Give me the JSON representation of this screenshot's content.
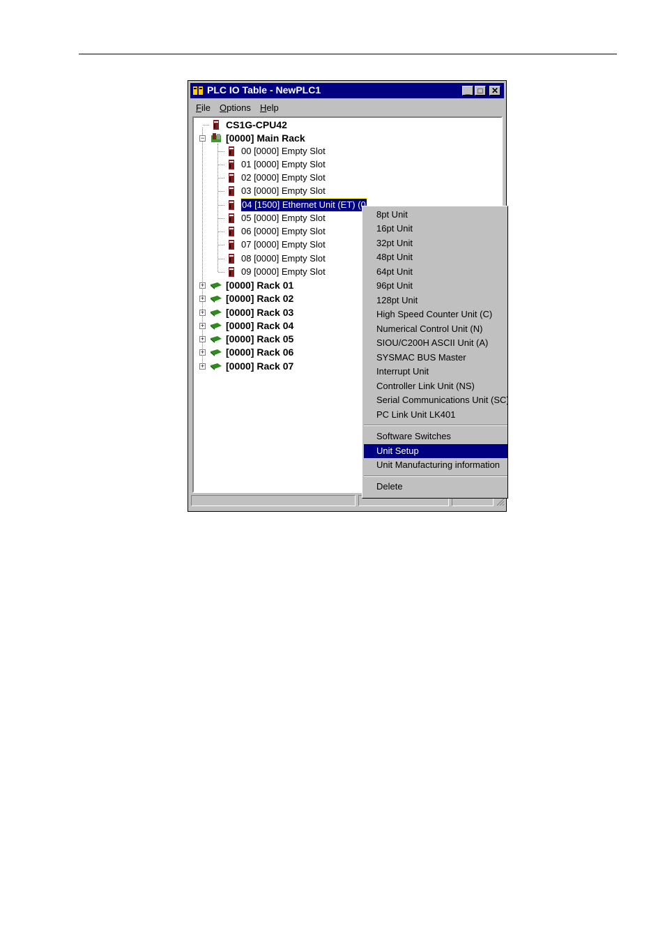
{
  "window": {
    "title": "PLC IO Table - NewPLC1",
    "min_glyph": "_",
    "max_glyph": "□",
    "close_glyph": "✕"
  },
  "menu": {
    "file": "File",
    "options": "Options",
    "help": "Help"
  },
  "tree": {
    "cpu": "CS1G-CPU42",
    "main_rack": "[0000] Main Rack",
    "slots": [
      "00 [0000] Empty Slot",
      "01 [0000] Empty Slot",
      "02 [0000] Empty Slot",
      "03 [0000] Empty Slot",
      "04 [1500] Ethernet Unit (ET) (0",
      "05 [0000] Empty Slot",
      "06 [0000] Empty Slot",
      "07 [0000] Empty Slot",
      "08 [0000] Empty Slot",
      "09 [0000] Empty Slot"
    ],
    "racks": [
      "[0000] Rack 01",
      "[0000] Rack 02",
      "[0000] Rack 03",
      "[0000] Rack 04",
      "[0000] Rack 05",
      "[0000] Rack 06",
      "[0000] Rack 07"
    ],
    "selected_slot": "04 [1500] Ethernet Unit (ET) (0"
  },
  "context_menu": {
    "items": [
      "8pt Unit",
      "16pt Unit",
      "32pt Unit",
      "48pt Unit",
      "64pt Unit",
      "96pt Unit",
      "128pt Unit",
      "High Speed Counter Unit (C)",
      "Numerical Control Unit (N)",
      "SIOU/C200H ASCII Unit (A)",
      "SYSMAC BUS Master",
      "Interrupt Unit",
      "Controller Link Unit (NS)",
      "Serial Communications Unit (SC)",
      "PC Link Unit LK401"
    ],
    "software_switches": "Software Switches",
    "unit_setup": "Unit Setup",
    "unit_manufacturing": "Unit Manufacturing information",
    "delete": "Delete",
    "highlighted": "Unit Setup"
  },
  "colors": {
    "titlebar": "#000080",
    "face": "#c0c0c0",
    "selection": "#000080",
    "rack_icon": "#2e8b1e"
  },
  "icons": {
    "cpu": "plc-module-icon",
    "main_rack": "main-rack-icon",
    "rack": "rack-icon",
    "slot": "plc-module-icon"
  }
}
